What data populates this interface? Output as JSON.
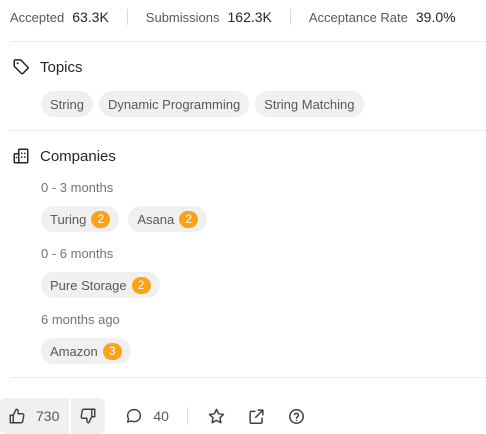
{
  "stats": {
    "accepted_label": "Accepted",
    "accepted_value": "63.3K",
    "submissions_label": "Submissions",
    "submissions_value": "162.3K",
    "acceptance_label": "Acceptance Rate",
    "acceptance_value": "39.0%"
  },
  "topics": {
    "title": "Topics",
    "icon": "tag-icon",
    "items": [
      "String",
      "Dynamic Programming",
      "String Matching"
    ]
  },
  "companies": {
    "title": "Companies",
    "icon": "building-icon",
    "groups": [
      {
        "period": "0 - 3 months",
        "items": [
          {
            "name": "Turing",
            "count": "2"
          },
          {
            "name": "Asana",
            "count": "2"
          }
        ]
      },
      {
        "period": "0 - 6 months",
        "items": [
          {
            "name": "Pure Storage",
            "count": "2"
          }
        ]
      },
      {
        "period": "6 months ago",
        "items": [
          {
            "name": "Amazon",
            "count": "3"
          }
        ]
      }
    ]
  },
  "footer": {
    "likes": "730",
    "comments": "40",
    "icons": [
      "thumbs-up-icon",
      "thumbs-down-icon",
      "comment-icon",
      "star-icon",
      "share-icon",
      "help-icon"
    ]
  },
  "colors": {
    "badge": "#ffa116",
    "chip_bg": "#f0f0f0",
    "text": "#262626",
    "muted": "#737373"
  }
}
